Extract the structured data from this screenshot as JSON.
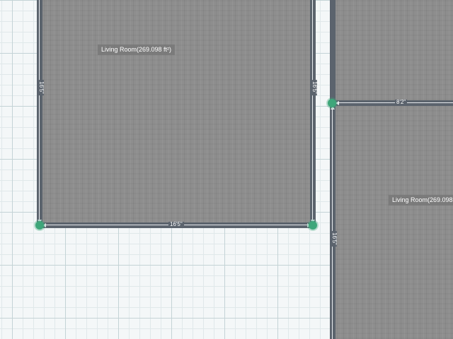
{
  "rooms": [
    {
      "label": "Living Room(269.098 ft²)",
      "dims": {
        "left": "16'5\"",
        "right": "16'5\"",
        "bottom": "16'5\""
      }
    },
    {
      "label": "Living Room(269.098",
      "dims": {
        "top": "8'2\"",
        "left": "16'5\""
      }
    }
  ],
  "colors": {
    "wall": "#5b636d",
    "handle": "#3ea67a",
    "floor": "#8e8e8e",
    "grid_major": "#c4d3d6",
    "grid_minor": "#e0e8ea"
  }
}
